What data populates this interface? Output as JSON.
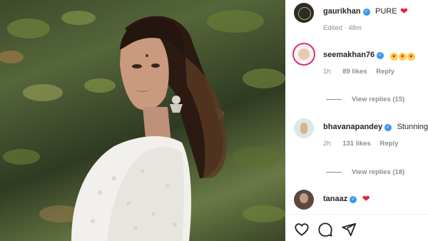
{
  "post": {
    "author": "gaurikhan",
    "caption_text": "PURE",
    "caption_emoji": "red-heart",
    "edited_label": "Edited · 48m"
  },
  "comments": [
    {
      "username": "seemakhan76",
      "verified": true,
      "emojis": [
        "star-struck",
        "star-struck",
        "star-struck"
      ],
      "time": "1h",
      "likes": "89 likes",
      "reply": "Reply",
      "view_replies": "View replies (15)"
    },
    {
      "username": "bhavanapandey",
      "verified": true,
      "text": "Stunning",
      "time": "2h",
      "likes": "131 likes",
      "reply": "Reply",
      "view_replies": "View replies (18)"
    },
    {
      "username": "tanaaz",
      "verified": true,
      "emoji": "red-heart"
    }
  ],
  "actions": [
    "heart-icon",
    "comment-icon",
    "share-icon"
  ],
  "colors": {
    "verified": "#3897f0",
    "heart": "#ed1c3a",
    "muted": "#8e8e8e"
  }
}
